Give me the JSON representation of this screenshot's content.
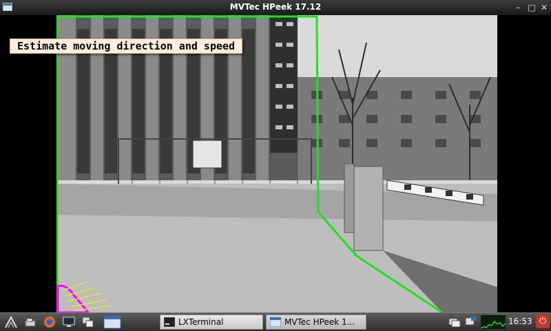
{
  "window": {
    "title": "MVTec HPeek 17.12",
    "minimize_glyph": "–",
    "maximize_glyph": "□",
    "close_glyph": "✕"
  },
  "scene": {
    "caption": "Estimate moving direction and speed"
  },
  "taskbar": {
    "tasks": [
      {
        "label": "LXTerminal",
        "icon": "terminal-icon"
      },
      {
        "label": "MVTec HPeek 1...",
        "icon": "window-icon"
      }
    ],
    "clock": "16:53",
    "power_glyph": "⏻"
  },
  "colors": {
    "overlay_green": "#22e01e",
    "overlay_magenta": "#ff00ff",
    "overlay_yellow": "#e6e23a",
    "caption_bg": "#fdeedd"
  }
}
